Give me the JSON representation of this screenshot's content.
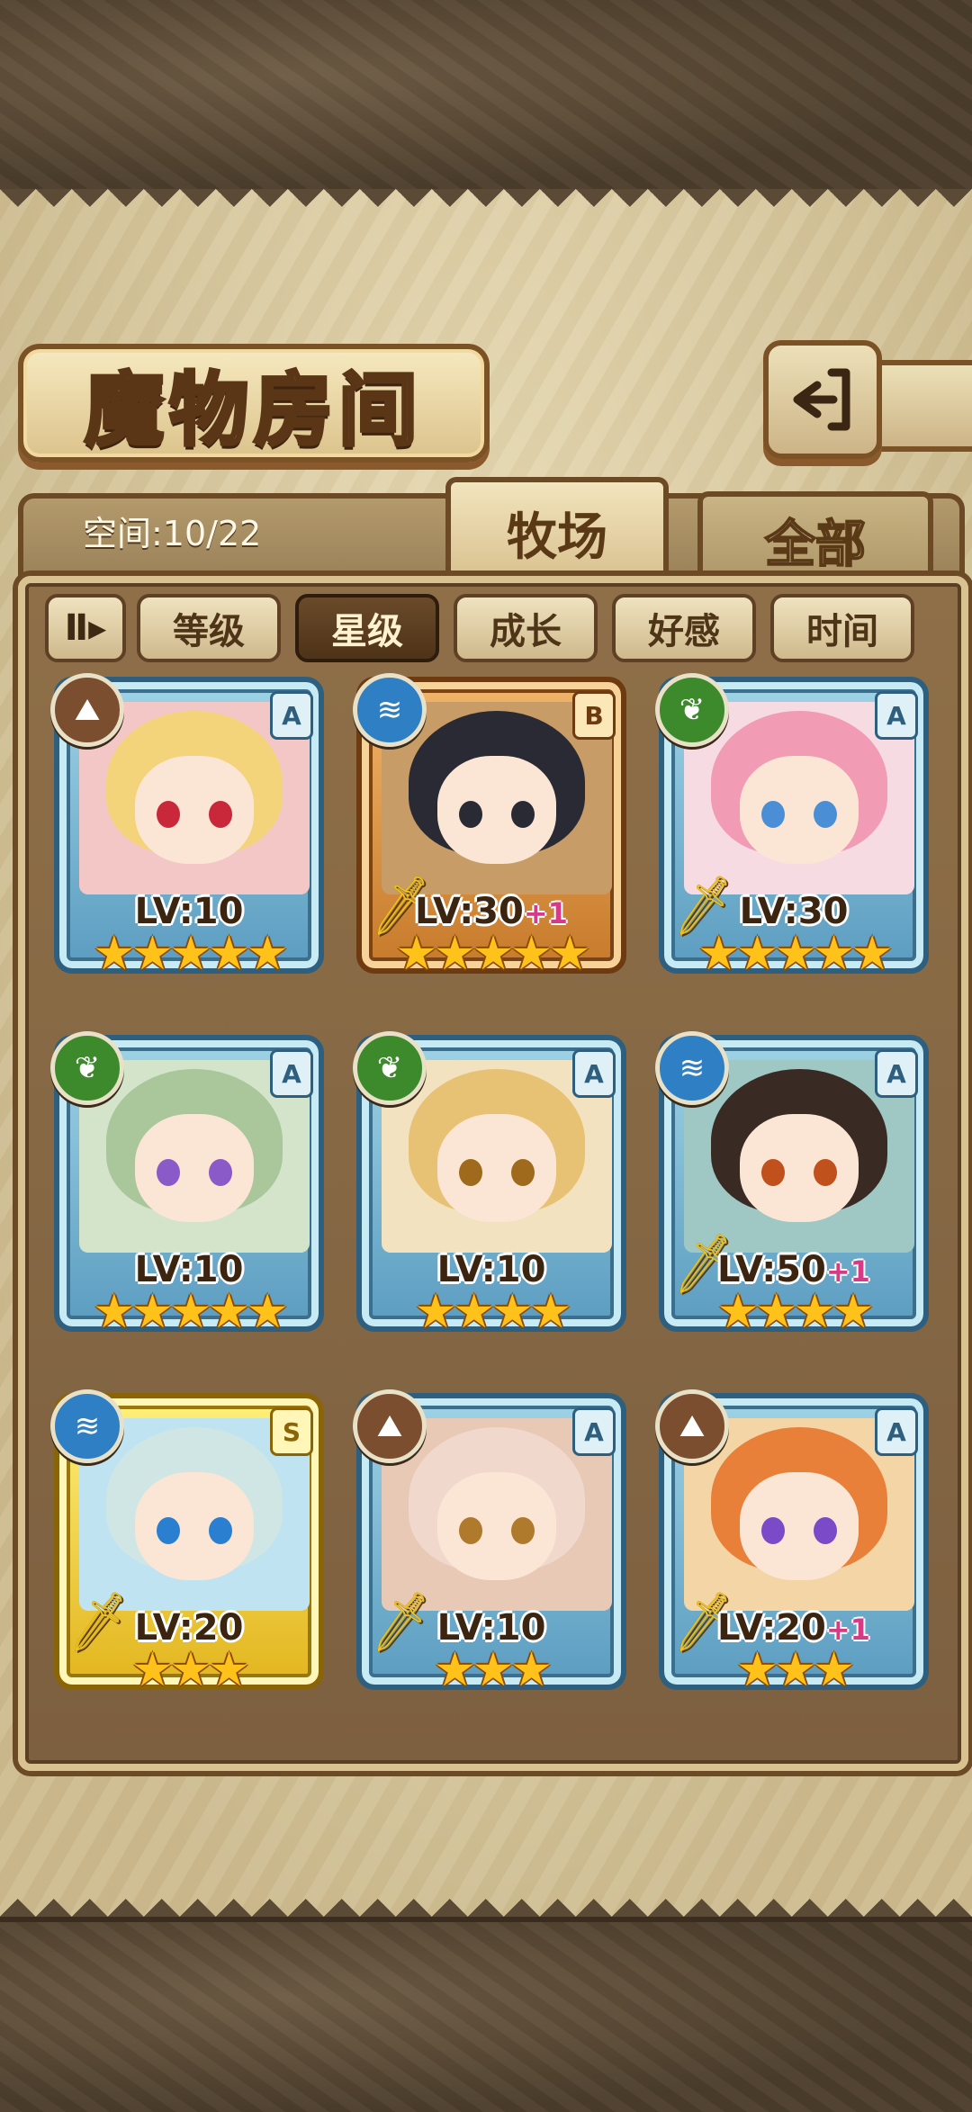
{
  "header": {
    "title": "魔物房间",
    "back_icon": "back-arrow-icon"
  },
  "tabs": {
    "space_label": "空间:10/22",
    "ranch_label": "牧场",
    "all_label": "全部"
  },
  "sort": {
    "toggle_icon": "sort-order-icon",
    "filters": [
      "等级",
      "星级",
      "成长",
      "好感",
      "时间"
    ],
    "active_filter": "星级"
  },
  "colors": {
    "frame_a": "#5b9cc0",
    "frame_b": "#c77a2a",
    "frame_s": "#e2b51e",
    "star": "#ffc21a",
    "plus": "#d63b86"
  },
  "monsters": [
    {
      "element": "earth",
      "rank": "A",
      "level": "LV:10",
      "plus": "",
      "stars": "★★★★★",
      "weapon": false,
      "hair": "#f3d47a",
      "bg": "#f4c7c7",
      "eye": "#c8283a"
    },
    {
      "element": "water",
      "rank": "B",
      "level": "LV:30",
      "plus": "+1",
      "stars": "★★★★★",
      "weapon": true,
      "hair": "#2a2a34",
      "bg": "#c89c66",
      "eye": "#2a2a34"
    },
    {
      "element": "wood",
      "rank": "A",
      "level": "LV:30",
      "plus": "",
      "stars": "★★★★★",
      "weapon": true,
      "hair": "#f19bb5",
      "bg": "#f7dbe3",
      "eye": "#4a8fd6"
    },
    {
      "element": "wood",
      "rank": "A",
      "level": "LV:10",
      "plus": "",
      "stars": "★★★★★",
      "weapon": false,
      "hair": "#a9c79b",
      "bg": "#d4e4cb",
      "eye": "#8a5ac8"
    },
    {
      "element": "wood",
      "rank": "A",
      "level": "LV:10",
      "plus": "",
      "stars": "★★★★",
      "weapon": false,
      "hair": "#e8c274",
      "bg": "#f2e2c0",
      "eye": "#a06a1c"
    },
    {
      "element": "water",
      "rank": "A",
      "level": "LV:50",
      "plus": "+1",
      "stars": "★★★★",
      "weapon": true,
      "hair": "#3a2a24",
      "bg": "#9fc7c4",
      "eye": "#c0501c"
    },
    {
      "element": "water",
      "rank": "S",
      "level": "LV:20",
      "plus": "",
      "stars": "★★★",
      "weapon": true,
      "hair": "#cfe6e4",
      "bg": "#bfe3f1",
      "eye": "#2a7fd0"
    },
    {
      "element": "earth",
      "rank": "A",
      "level": "LV:10",
      "plus": "",
      "stars": "★★★",
      "weapon": true,
      "hair": "#f0d8cc",
      "bg": "#e7c9b5",
      "eye": "#b07a2c"
    },
    {
      "element": "earth",
      "rank": "A",
      "level": "LV:20",
      "plus": "+1",
      "stars": "★★★",
      "weapon": true,
      "hair": "#e8803a",
      "bg": "#f4d6a6",
      "eye": "#7a4ac8"
    }
  ]
}
